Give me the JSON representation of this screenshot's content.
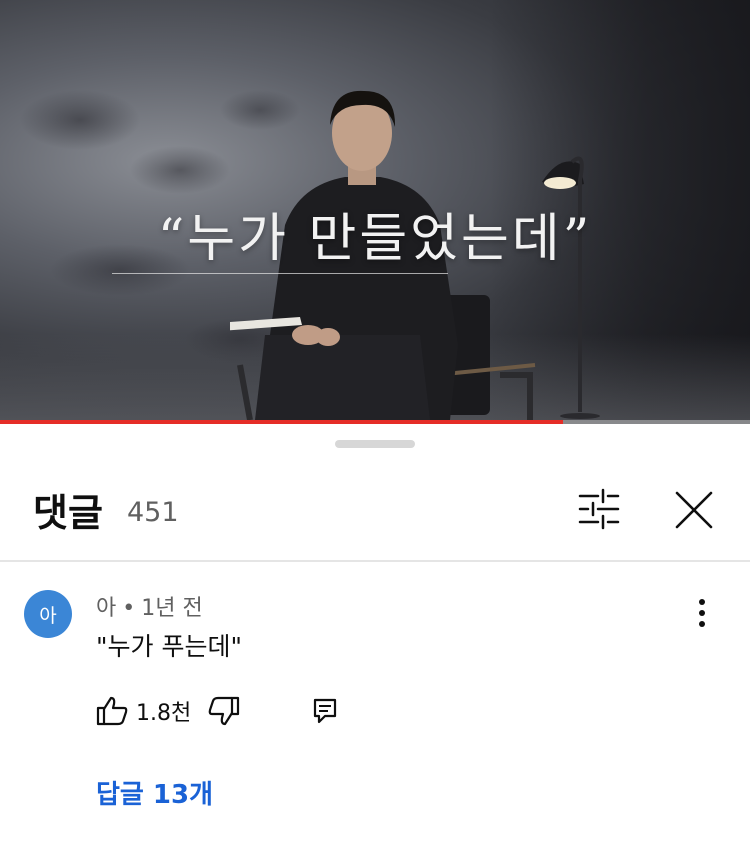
{
  "video": {
    "overlay_quote": "“누가 만들었는데”",
    "progress_fraction": 0.75,
    "progress_color": "#e52d27"
  },
  "comments_panel": {
    "title": "댓글",
    "count": "451",
    "filter_icon": "sliders-icon",
    "close_icon": "close-icon"
  },
  "comment": {
    "avatar_letter": "아",
    "avatar_color": "#3b86d6",
    "author": "아",
    "separator": "•",
    "time": "1년 전",
    "text": "\"누가 푸는데\"",
    "like_count": "1.8천",
    "more_icon": "more-vert-icon",
    "like_icon": "thumbs-up-icon",
    "dislike_icon": "thumbs-down-icon",
    "reply_icon": "comment-icon",
    "replies_label": "답글 13개",
    "link_color": "#1a62d6"
  }
}
